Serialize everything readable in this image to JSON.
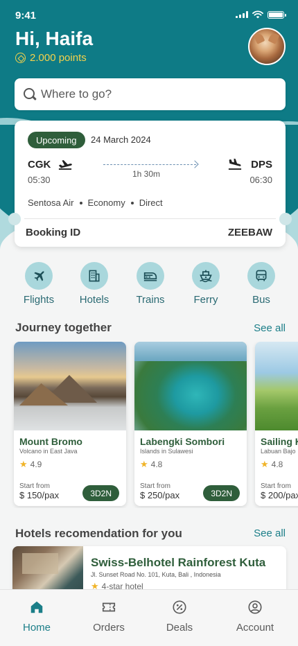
{
  "status_bar": {
    "time": "9:41"
  },
  "header": {
    "greeting": "Hi, Haifa",
    "points": "2.000 points"
  },
  "search": {
    "placeholder": "Where to go?"
  },
  "booking": {
    "status": "Upcoming",
    "date": "24 March 2024",
    "from_code": "CGK",
    "from_time": "05:30",
    "to_code": "DPS",
    "to_time": "06:30",
    "duration": "1h 30m",
    "airline": "Sentosa Air",
    "class": "Economy",
    "type": "Direct",
    "booking_id_label": "Booking ID",
    "booking_id": "ZEEBAW"
  },
  "categories": [
    {
      "label": "Flights",
      "icon": "airplane-icon"
    },
    {
      "label": "Hotels",
      "icon": "building-icon"
    },
    {
      "label": "Trains",
      "icon": "train-icon"
    },
    {
      "label": "Ferry",
      "icon": "ship-icon"
    },
    {
      "label": "Bus",
      "icon": "bus-icon"
    }
  ],
  "journey": {
    "title": "Journey together",
    "see_all": "See all",
    "items": [
      {
        "name": "Mount Bromo",
        "location": "Volcano in East Java",
        "rating": "4.9",
        "from_label": "Start from",
        "price": "$ 150/pax",
        "duration": "3D2N"
      },
      {
        "name": "Labengki Sombori",
        "location": "Islands in Sulawesi",
        "rating": "4.8",
        "from_label": "Start from",
        "price": "$ 250/pax",
        "duration": "3D2N"
      },
      {
        "name": "Sailing K",
        "location": "Labuan Bajo",
        "rating": "4.8",
        "from_label": "Start from",
        "price": "$ 200/pax",
        "duration": ""
      }
    ]
  },
  "hotels": {
    "title": "Hotels recomendation for you",
    "see_all": "See all",
    "items": [
      {
        "name": "Swiss-Belhotel Rainforest Kuta",
        "address": "Jl. Sunset Road No. 101, Kuta, Bali , Indonesia",
        "stars": "4-star hotel"
      }
    ]
  },
  "nav": [
    {
      "label": "Home",
      "icon": "home-icon",
      "active": true
    },
    {
      "label": "Orders",
      "icon": "ticket-icon",
      "active": false
    },
    {
      "label": "Deals",
      "icon": "percent-icon",
      "active": false
    },
    {
      "label": "Account",
      "icon": "user-icon",
      "active": false
    }
  ],
  "colors": {
    "primary": "#0e7b86",
    "primary_light": "#a9d7dc",
    "dark_green": "#2f5e3b",
    "accent_yellow": "#f5d24b",
    "link": "#1b7e88"
  }
}
